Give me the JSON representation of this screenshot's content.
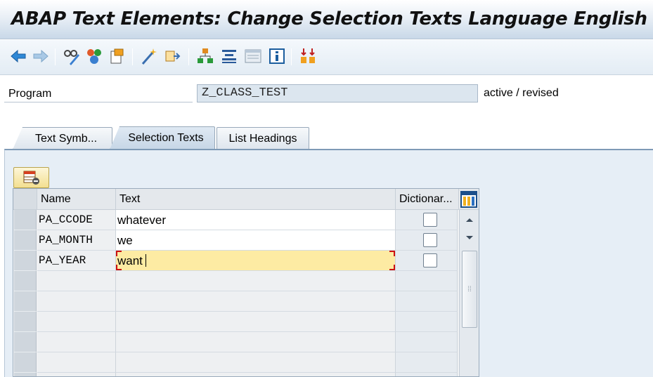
{
  "window": {
    "title": "ABAP Text Elements: Change Selection Texts Language English"
  },
  "toolbar": {
    "buttons": [
      {
        "icon": "back-arrow-icon"
      },
      {
        "icon": "forward-arrow-icon"
      },
      {
        "icon": "display-change-icon"
      },
      {
        "icon": "activate-icon"
      },
      {
        "icon": "other-object-icon"
      },
      {
        "icon": "magic-wand-icon"
      },
      {
        "icon": "where-used-icon"
      },
      {
        "icon": "hierarchy-icon"
      },
      {
        "icon": "compare-icon"
      },
      {
        "icon": "details-icon"
      },
      {
        "icon": "info-icon"
      },
      {
        "icon": "sort-icon"
      }
    ]
  },
  "header": {
    "program_label": "Program",
    "program_value": "Z_CLASS_TEST",
    "status": "active / revised"
  },
  "tabs": [
    {
      "label": "Text Symb...",
      "active": false
    },
    {
      "label": "Selection Texts",
      "active": true
    },
    {
      "label": "List Headings",
      "active": false
    }
  ],
  "grid": {
    "columns": {
      "name": "Name",
      "text": "Text",
      "dictionary": "Dictionar..."
    },
    "rows": [
      {
        "name": "PA_CCODE",
        "text": "whatever",
        "dictionary_ref": false
      },
      {
        "name": "PA_MONTH",
        "text": "we",
        "dictionary_ref": false
      },
      {
        "name": "PA_YEAR",
        "text": "want",
        "dictionary_ref": false,
        "current": true
      }
    ],
    "empty_rows": 6
  },
  "colors": {
    "title_gradient_bottom": "#c8d8e8",
    "active_cell": "#fdeba3",
    "panel_background": "#e6eef6",
    "cursor_corner": "#cc1010"
  }
}
